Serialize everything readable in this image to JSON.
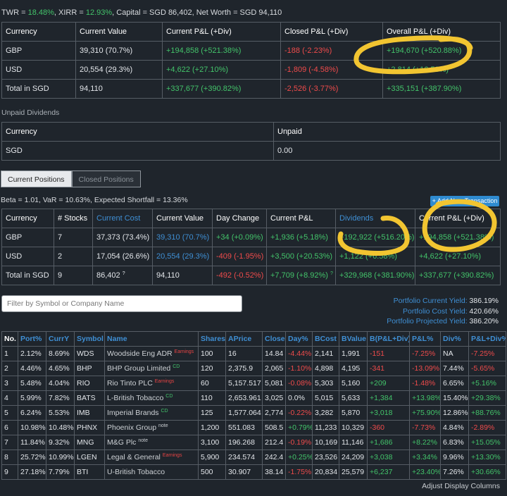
{
  "summary": {
    "twr_label": "TWR = ",
    "twr": "18.48%",
    "xirr_label": ", XIRR = ",
    "xirr": "12.93%",
    "rest": ", Capital = SGD 86,402, Net Worth = SGD 94,110",
    "headers": [
      "Currency",
      "Current Value",
      "Current P&L (+Div)",
      "Closed P&L (+Div)",
      "Overall P&L (+Div)"
    ],
    "rows": [
      [
        "GBP",
        "39,310 (70.7%)",
        "+194,858 (+521.38%)",
        "-188 (-2.23%)",
        "+194,670 (+520.88%)"
      ],
      [
        "USD",
        "20,554 (29.3%)",
        "+4,622 (+27.10%)",
        "-1,809 (-4.58%)",
        "+2,814 (+16.50%)"
      ],
      [
        "Total in SGD",
        "94,110",
        "+337,677 (+390.82%)",
        "-2,526 (-3.77%)",
        "+335,151 (+387.90%)"
      ]
    ]
  },
  "unpaid": {
    "title": "Unpaid Dividends",
    "headers": [
      "Currency",
      "Unpaid"
    ],
    "rows": [
      [
        "SGD",
        "0.00"
      ]
    ]
  },
  "tabs": [
    "Current Positions",
    "Closed Positions"
  ],
  "risk_line": "Beta = 1.01, VaR = 10.63%, Expected Shortfall = 13.36%",
  "add_button": "+ Add New Transaction",
  "positions": {
    "headers": [
      "Currency",
      "# Stocks",
      "Current Cost",
      "Current Value",
      "Day Change",
      "Current P&L",
      "Dividends",
      "Current P&L (+Div)"
    ],
    "rows": [
      [
        "GBP",
        "7",
        "37,373 (73.4%)",
        "39,310 (70.7%)",
        "+34 (+0.09%)",
        "+1,936 (+5.18%)",
        "+192,922 (+516.20%)",
        "+194,858 (+521.38%)"
      ],
      [
        "USD",
        "2",
        "17,054 (26.6%)",
        "20,554 (29.3%)",
        "-409 (-1.95%)",
        "+3,500 (+20.53%)",
        "+1,122 (+6.58%)",
        "+4,622 (+27.10%)"
      ],
      [
        "Total in SGD",
        "9",
        "86,402",
        "94,110",
        "-492 (-0.52%)",
        "+7,709 (+8.92%)",
        "+329,968 (+381.90%)",
        "+337,677 (+390.82%)"
      ]
    ],
    "info_mark": "?"
  },
  "filter_placeholder": "Filter by Symbol or Company Name",
  "yields": [
    {
      "label": "Portfolio Current Yield:",
      "value": "386.19%"
    },
    {
      "label": "Portfolio Cost Yield:",
      "value": "420.66%"
    },
    {
      "label": "Portfolio Projected Yield:",
      "value": "386.20%"
    }
  ],
  "holdings": {
    "headers": [
      "No.",
      "Port%",
      "CurrY",
      "Symbol",
      "Name",
      "Shares",
      "APrice",
      "Close",
      "Day%",
      "BCost",
      "BValue",
      "B(P&L+Div)",
      "P&L%",
      "Div%",
      "P&L+Div%"
    ],
    "rows": [
      {
        "no": "1",
        "port": "2.12%",
        "curry": "8.69%",
        "sym": "WDS",
        "name": "Woodside Eng ADR",
        "tag": "Earnings",
        "tagtype": "earn",
        "shares": "100",
        "aprice": "16",
        "close": "14.84",
        "day": "-4.44%",
        "bcost": "2,141",
        "bvalue": "1,991",
        "bpl": "-151",
        "pl": "-7.25%",
        "div": "NA",
        "pldiv": "-7.25%"
      },
      {
        "no": "2",
        "port": "4.46%",
        "curry": "4.65%",
        "sym": "BHP",
        "name": "BHP Group Limited",
        "tag": "CD",
        "tagtype": "cd",
        "shares": "120",
        "aprice": "2,375.9",
        "close": "2,065",
        "day": "-1.10%",
        "bcost": "4,898",
        "bvalue": "4,195",
        "bpl": "-341",
        "pl": "-13.09%",
        "div": "7.44%",
        "pldiv": "-5.65%"
      },
      {
        "no": "3",
        "port": "5.48%",
        "curry": "4.04%",
        "sym": "RIO",
        "name": "Rio Tinto PLC",
        "tag": "Earnings",
        "tagtype": "earn",
        "shares": "60",
        "aprice": "5,157.517",
        "close": "5,081",
        "day": "-0.08%",
        "bcost": "5,303",
        "bvalue": "5,160",
        "bpl": "+209",
        "pl": "-1.48%",
        "div": "6.65%",
        "pldiv": "+5.16%"
      },
      {
        "no": "4",
        "port": "5.99%",
        "curry": "7.82%",
        "sym": "BATS",
        "name": "L-British Tobacco",
        "tag": "CD",
        "tagtype": "cd",
        "shares": "110",
        "aprice": "2,653.961",
        "close": "3,025",
        "day": "0.0%",
        "bcost": "5,015",
        "bvalue": "5,633",
        "bpl": "+1,384",
        "pl": "+13.98%",
        "div": "15.40%",
        "pldiv": "+29.38%"
      },
      {
        "no": "5",
        "port": "6.24%",
        "curry": "5.53%",
        "sym": "IMB",
        "name": "Imperial Brands",
        "tag": "CD",
        "tagtype": "cd",
        "shares": "125",
        "aprice": "1,577.064",
        "close": "2,774",
        "day": "-0.22%",
        "bcost": "3,282",
        "bvalue": "5,870",
        "bpl": "+3,018",
        "pl": "+75.90%",
        "div": "12.86%",
        "pldiv": "+88.76%"
      },
      {
        "no": "6",
        "port": "10.98%",
        "curry": "10.48%",
        "sym": "PHNX",
        "name": "Phoenix Group",
        "tag": "note",
        "tagtype": "note",
        "shares": "1,200",
        "aprice": "551.083",
        "close": "508.5",
        "day": "+0.79%",
        "bcost": "11,233",
        "bvalue": "10,329",
        "bpl": "-360",
        "pl": "-7.73%",
        "div": "4.84%",
        "pldiv": "-2.89%"
      },
      {
        "no": "7",
        "port": "11.84%",
        "curry": "9.32%",
        "sym": "MNG",
        "name": "M&G Plc",
        "tag": "note",
        "tagtype": "note",
        "shares": "3,100",
        "aprice": "196.268",
        "close": "212.4",
        "day": "-0.19%",
        "bcost": "10,169",
        "bvalue": "11,146",
        "bpl": "+1,686",
        "pl": "+8.22%",
        "div": "6.83%",
        "pldiv": "+15.05%"
      },
      {
        "no": "8",
        "port": "25.72%",
        "curry": "10.99%",
        "sym": "LGEN",
        "name": "Legal & General",
        "tag": "Earnings",
        "tagtype": "earn",
        "shares": "5,900",
        "aprice": "234.574",
        "close": "242.4",
        "day": "+0.25%",
        "bcost": "23,526",
        "bvalue": "24,209",
        "bpl": "+3,038",
        "pl": "+3.34%",
        "div": "9.96%",
        "pldiv": "+13.30%"
      },
      {
        "no": "9",
        "port": "27.18%",
        "curry": "7.79%",
        "sym": "BTI",
        "name": "U-British Tobacco",
        "tag": "",
        "tagtype": "",
        "shares": "500",
        "aprice": "30.907",
        "close": "38.14",
        "day": "-1.75%",
        "bcost": "20,834",
        "bvalue": "25,579",
        "bpl": "+6,237",
        "pl": "+23.40%",
        "div": "7.26%",
        "pldiv": "+30.66%"
      }
    ]
  },
  "adjust_label": "Adjust Display Columns",
  "colors": {
    "positive": "#43c36a",
    "negative": "#ef4b4b",
    "link": "#3f8fd4",
    "background": "#1f252c",
    "annotation": "#f2c531"
  }
}
